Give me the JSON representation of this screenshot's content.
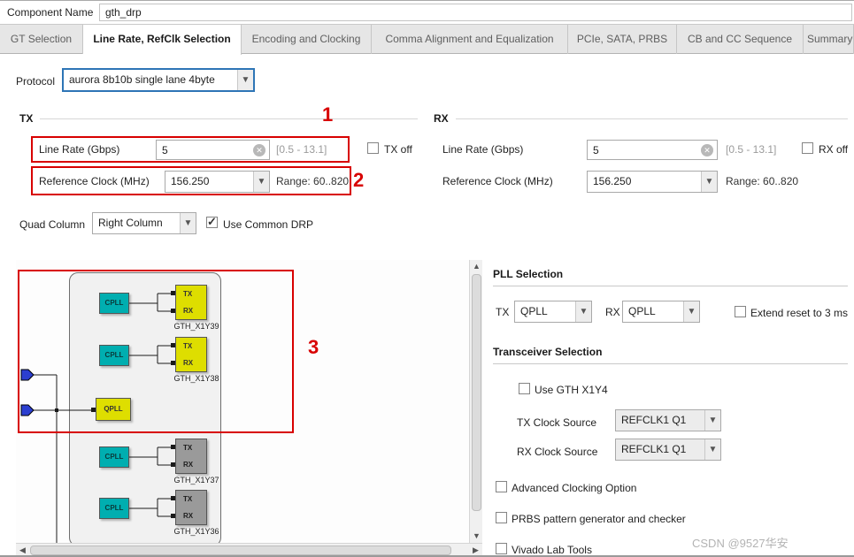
{
  "colors": {
    "annotation_red": "#d80000",
    "highlight_blue": "#2e75b6",
    "cpll_teal": "#00aeb0",
    "pll_yellow": "#dede00",
    "inactive_gray": "#9a9a9a"
  },
  "header": {
    "component_name_label": "Component Name",
    "component_name_value": "gth_drp"
  },
  "tabs": [
    {
      "label": "GT Selection"
    },
    {
      "label": "Line Rate, RefClk Selection"
    },
    {
      "label": "Encoding and Clocking"
    },
    {
      "label": "Comma Alignment and Equalization"
    },
    {
      "label": "PCIe, SATA, PRBS"
    },
    {
      "label": "CB and CC Sequence"
    },
    {
      "label": "Summary"
    }
  ],
  "protocol": {
    "label": "Protocol",
    "value": "aurora 8b10b single lane 4byte"
  },
  "tx": {
    "section_title": "TX",
    "line_rate_label": "Line Rate (Gbps)",
    "line_rate_value": "5",
    "line_rate_range": "[0.5 - 13.1]",
    "off_label": "TX off",
    "refclk_label": "Reference Clock (MHz)",
    "refclk_value": "156.250",
    "refclk_range": "Range: 60..820"
  },
  "rx": {
    "section_title": "RX",
    "line_rate_label": "Line Rate (Gbps)",
    "line_rate_value": "5",
    "line_rate_range": "[0.5 - 13.1]",
    "off_label": "RX off",
    "refclk_label": "Reference Clock (MHz)",
    "refclk_value": "156.250",
    "refclk_range": "Range: 60..820"
  },
  "quad": {
    "label": "Quad Column",
    "value": "Right Column",
    "common_drp_label": "Use Common DRP",
    "common_drp_checked": true
  },
  "diagram": {
    "cpll_label": "CPLL",
    "qpll_label": "QPLL",
    "tx_label": "TX",
    "rx_label": "RX",
    "lanes": [
      {
        "name": "GTH_X1Y39",
        "active": true
      },
      {
        "name": "GTH_X1Y38",
        "active": true
      },
      {
        "name": "GTH_X1Y37",
        "active": false
      },
      {
        "name": "GTH_X1Y36",
        "active": false
      }
    ]
  },
  "pll_selection": {
    "title": "PLL Selection",
    "tx_label": "TX",
    "tx_value": "QPLL",
    "rx_label": "RX",
    "rx_value": "QPLL",
    "extend_reset_label": "Extend reset to 3 ms"
  },
  "transceiver_selection": {
    "title": "Transceiver Selection",
    "use_gth_label": "Use GTH X1Y4",
    "tx_clock_label": "TX Clock Source",
    "tx_clock_value": "REFCLK1 Q1",
    "rx_clock_label": "RX Clock Source",
    "rx_clock_value": "REFCLK1 Q1"
  },
  "options": {
    "advanced_clocking": "Advanced Clocking Option",
    "prbs": "PRBS pattern generator and checker",
    "vivado_lab": "Vivado Lab Tools"
  },
  "annotations": {
    "one": "1",
    "two": "2",
    "three": "3"
  },
  "watermark": "CSDN @9527华安"
}
